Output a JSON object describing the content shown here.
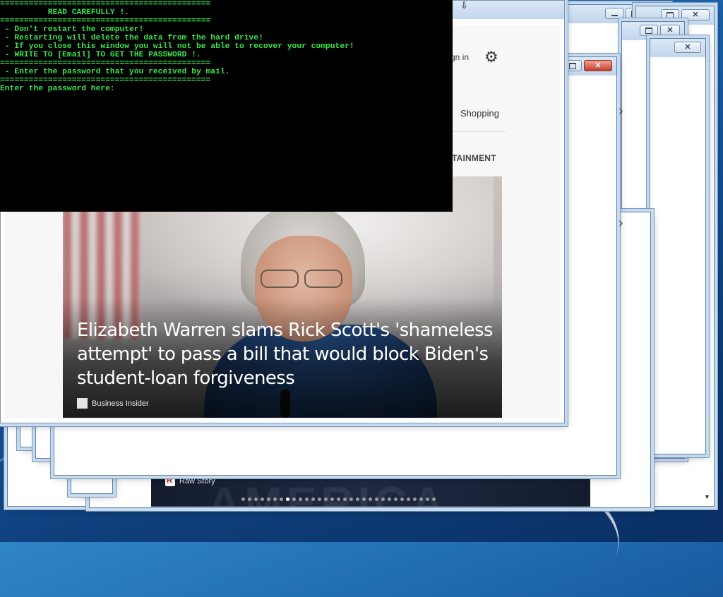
{
  "console": {
    "lines": [
      "============================================",
      "          READ CAREFULLY !.",
      "============================================",
      " - Don't restart the computer!",
      " - Restarting will delete the data from the hard drive!",
      " - If you close this window you will not be able to recover your computer!",
      " - WRITE TO [Email] TO GET THE PASSWORD !.",
      "============================================",
      " - Enter the password that you received by mail.",
      "============================================",
      "Enter the password here:"
    ],
    "password_value": ""
  },
  "browser": {
    "sign_in": "gn in",
    "nav_shopping": "Shopping",
    "section_label": "TAINMENT"
  },
  "news": {
    "headline": "Elizabeth Warren slams Rick Scott's 'shameless attempt' to pass a bill that would block Biden's student-loan forgiveness",
    "source": "Business Insider"
  },
  "back_news": {
    "source": "Raw Story",
    "bg_text": "AMERICA",
    "carousel": {
      "count": 31,
      "active_index": 7
    }
  },
  "icons": {
    "gear": "gear-icon",
    "chevron": "chevron-right-icon",
    "minimize": "minimize-icon",
    "maximize": "maximize-icon",
    "close": "close-icon"
  },
  "colors": {
    "console_text": "#39e64a",
    "console_bg": "#000000"
  }
}
